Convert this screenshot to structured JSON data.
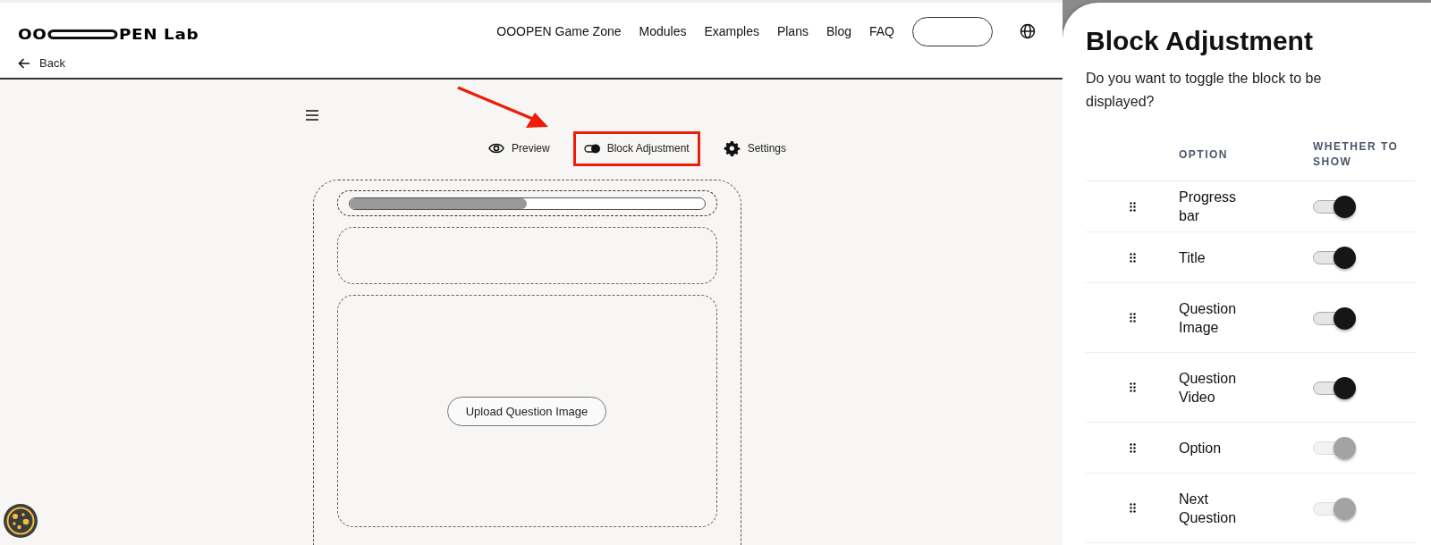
{
  "logo": {
    "prefix": "OO",
    "suffix": "PEN Lab"
  },
  "back": "Back",
  "nav": [
    "OOOPEN Game Zone",
    "Modules",
    "Examples",
    "Plans",
    "Blog",
    "FAQ"
  ],
  "toolbar": [
    {
      "kind": "preview",
      "label": "Preview",
      "highlighted": false
    },
    {
      "kind": "blocks",
      "label": "Block Adjustment",
      "highlighted": true
    },
    {
      "kind": "settings",
      "label": "Settings",
      "highlighted": false
    }
  ],
  "preview": {
    "progress": {
      "level": 0.5
    },
    "upload_button": "Upload Question Image"
  },
  "panel": {
    "title": "Block Adjustment",
    "prompt": "Do you want to toggle the block to be displayed?",
    "columns": [
      "OPTION",
      "WHETHER TO SHOW"
    ],
    "rows": [
      {
        "label": "Progress bar",
        "on": true
      },
      {
        "label": "Title",
        "on": true
      },
      {
        "label": "Question Image",
        "on": true
      },
      {
        "label": "Question Video",
        "on": true
      },
      {
        "label": "Option",
        "on": false
      },
      {
        "label": "Next Question",
        "on": false
      }
    ]
  }
}
